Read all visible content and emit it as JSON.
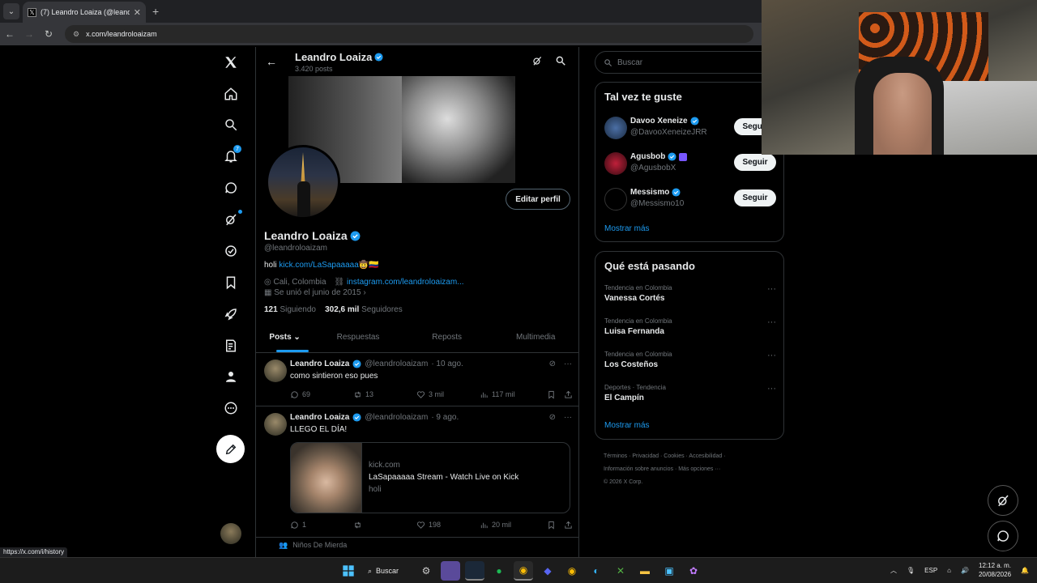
{
  "browser": {
    "tab_title": "(7) Leandro Loaiza (@leandrolo",
    "url": "x.com/leandroloaizam",
    "status_url": "https://x.com/i/history"
  },
  "nav": {
    "notifications_badge": "7"
  },
  "profile": {
    "name": "Leandro Loaiza",
    "posts_count": "3.420 posts",
    "handle": "@leandroloaizam",
    "bio_prefix": "holi ",
    "bio_link": "kick.com/LaSapaaaaa",
    "bio_emoji": "🤠🇨🇴",
    "location": "Cali, Colombia",
    "website": "instagram.com/leandroloaizam...",
    "joined": "Se unió el junio de 2015",
    "following_count": "121",
    "following_label": "Siguiendo",
    "followers_count": "302,6 mil",
    "followers_label": "Seguidores",
    "edit_button": "Editar perfil"
  },
  "tabs": [
    "Posts",
    "Respuestas",
    "Reposts",
    "Multimedia"
  ],
  "posts": [
    {
      "name": "Leandro Loaiza",
      "handle": "@leandroloaizam",
      "date": "· 10 ago.",
      "text": "como sintieron eso pues",
      "replies": "69",
      "reposts": "13",
      "likes": "3 mil",
      "views": "117 mil"
    },
    {
      "name": "Leandro Loaiza",
      "handle": "@leandroloaizam",
      "date": "· 9 ago.",
      "text": "LLEGO EL DÍA!",
      "card_domain": "kick.com",
      "card_title": "LaSapaaaaa Stream - Watch Live on Kick",
      "card_desc": "holi",
      "replies": "1",
      "reposts": "",
      "likes": "198",
      "views": "20 mil"
    }
  ],
  "repost_label": "Niños De Mierda",
  "right": {
    "search_placeholder": "Buscar",
    "suggest_title": "Tal vez te guste",
    "suggestions": [
      {
        "name": "Davoo Xeneize",
        "handle": "@DavooXeneizeJRR",
        "button": "Seguir"
      },
      {
        "name": "Agusbob",
        "handle": "@AgusbobX",
        "button": "Seguir"
      },
      {
        "name": "Messismo",
        "handle": "@Messismo10",
        "button": "Seguir"
      }
    ],
    "show_more": "Mostrar más",
    "trends_title": "Qué está pasando",
    "trends": [
      {
        "context": "Tendencia en Colombia",
        "name": "Vanessa Cortés"
      },
      {
        "context": "Tendencia en Colombia",
        "name": "Luisa Fernanda"
      },
      {
        "context": "Tendencia en Colombia",
        "name": "Los Costeños"
      },
      {
        "context": "Deportes · Tendencia",
        "name": "El Campín"
      }
    ],
    "footer_line1": "Términos  ·  Privacidad  ·  Cookies  ·  Accesibilidad  ·",
    "footer_line2": "Información sobre anuncios  ·  Más opciones ···",
    "footer_line3": "© 2026 X Corp."
  },
  "taskbar": {
    "search_label": "Buscar",
    "lang": "ESP",
    "time": "12:12 a. m.",
    "date": "20/08/2026"
  },
  "colors": {
    "accent": "#1d9bf0",
    "background": "#000000",
    "border": "#2f3336",
    "muted": "#71767b"
  }
}
